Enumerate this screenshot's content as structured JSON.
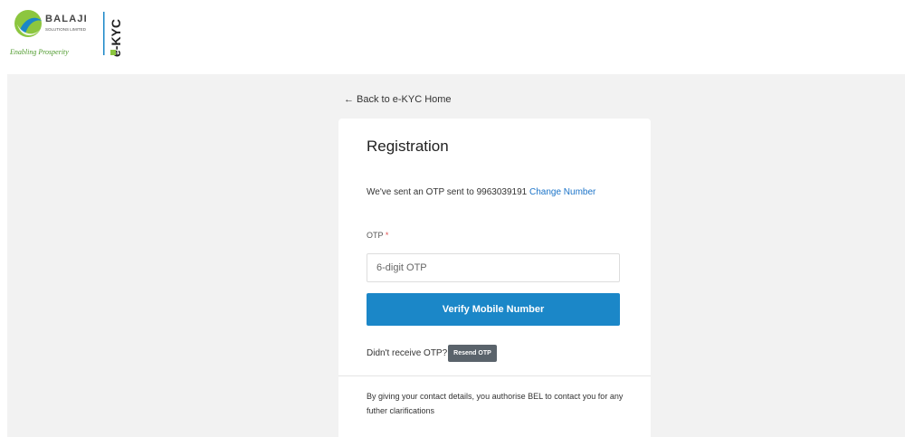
{
  "header": {
    "brand_name": "BALAJI",
    "brand_sub": "SOLUTIONS LIMITED",
    "tagline": "Enabling Prosperity",
    "product": "e-KYC"
  },
  "nav": {
    "back_arrow": "←",
    "back_label": "Back to e-KYC Home"
  },
  "registration": {
    "title": "Registration",
    "otp_message": "We've sent an OTP sent to 9963039191",
    "change_number_label": "Change Number",
    "otp_label": "OTP",
    "required_mark": "*",
    "otp_placeholder": "6-digit OTP",
    "otp_value": "",
    "verify_button": "Verify Mobile Number",
    "resend_prompt": "Didn't receive OTP?",
    "resend_button": "Resend OTP",
    "consent_text": "By giving your contact details, you authorise BEL to contact you for any futher clarifications"
  },
  "colors": {
    "primary": "#1b87c8",
    "link": "#1a73c8",
    "resend_bg": "#5a636b",
    "page_bg": "#f2f2f2",
    "logo_green": "#8cc63f",
    "logo_blue": "#1b87c8"
  }
}
